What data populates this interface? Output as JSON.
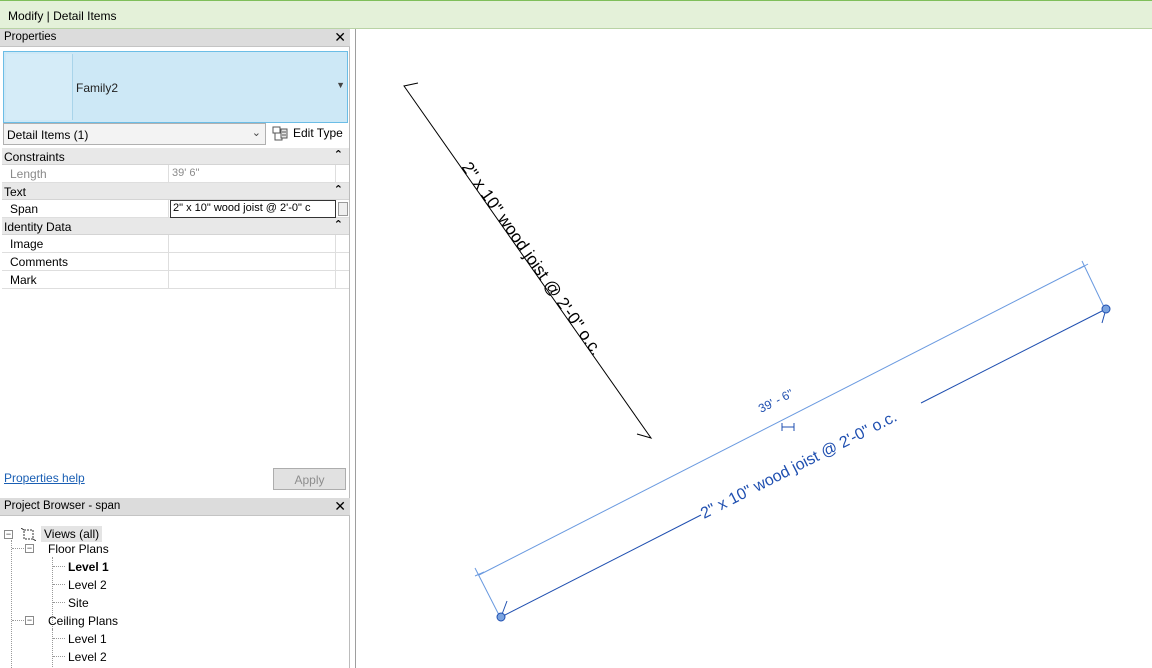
{
  "ribbon": {
    "context_title": "Modify | Detail Items"
  },
  "properties": {
    "panel_title": "Properties",
    "type_name": "Family2",
    "instance_filter": "Detail Items (1)",
    "edit_type_label": "Edit Type",
    "groups": {
      "constraints": {
        "name": "Constraints",
        "length_label": "Length",
        "length_value": "39'  6\""
      },
      "text": {
        "name": "Text",
        "span_label": "Span",
        "span_value": "2\" x 10\" wood joist @ 2'-0\" c"
      },
      "identity": {
        "name": "Identity Data",
        "image_label": "Image",
        "comments_label": "Comments",
        "mark_label": "Mark"
      }
    },
    "help_link": "Properties help",
    "apply_label": "Apply"
  },
  "browser": {
    "panel_title": "Project Browser - span",
    "views_all": "Views (all)",
    "floor_plans": "Floor Plans",
    "fp_level1": "Level 1",
    "fp_level2": "Level 2",
    "fp_site": "Site",
    "ceiling_plans": "Ceiling Plans",
    "cp_level1": "Level 1",
    "cp_level2": "Level 2"
  },
  "canvas": {
    "loose_annotation": "2\" x 10\" wood joist @ 2'-0\" o.c.",
    "selected_annotation": "2\" x 10\" wood joist @ 2'-0\" o.c.",
    "dimension_value": "39' - 6\"",
    "colors": {
      "selected": "#1f4fb0",
      "dimension": "#6a9ae0",
      "grip": "#7aa3e0"
    }
  }
}
